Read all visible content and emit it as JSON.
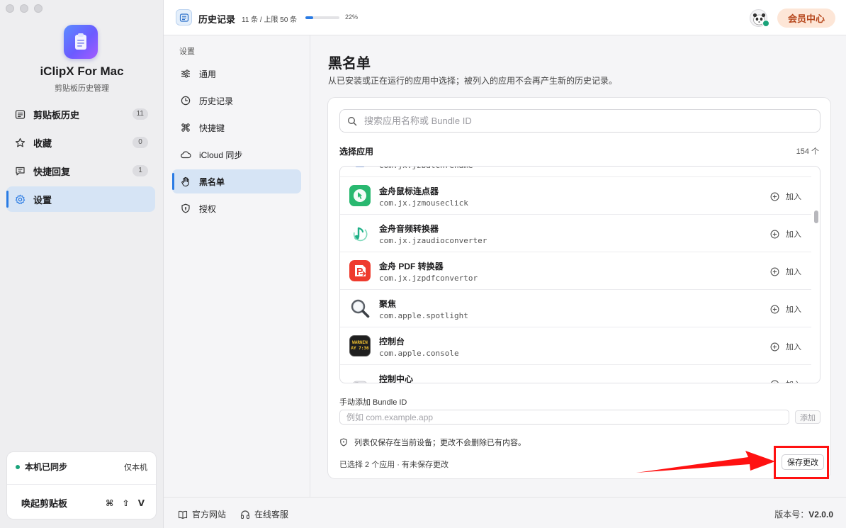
{
  "sidebar": {
    "app_name": "iClipX For Mac",
    "app_subtitle": "剪贴板历史管理",
    "items": [
      {
        "label": "剪贴板历史",
        "badge": "11"
      },
      {
        "label": "收藏",
        "badge": "0"
      },
      {
        "label": "快捷回复",
        "badge": "1"
      },
      {
        "label": "设置",
        "badge": ""
      }
    ],
    "sync": {
      "status": "本机已同步",
      "scope": "仅本机"
    },
    "wake": {
      "label": "唤起剪贴板",
      "shortcut": "⌘ ⇧ V"
    }
  },
  "topbar": {
    "title": "历史记录",
    "count": "11 条 / 上限 50 条",
    "progress": 0.22,
    "percent": "22%",
    "vip_label": "会员中心"
  },
  "settings_nav": {
    "heading": "设置",
    "items": [
      {
        "label": "通用",
        "icon": "sliders-icon"
      },
      {
        "label": "历史记录",
        "icon": "clock-icon"
      },
      {
        "label": "快捷键",
        "icon": "command-icon"
      },
      {
        "label": "iCloud 同步",
        "icon": "cloud-icon"
      },
      {
        "label": "黑名单",
        "icon": "hand-icon"
      },
      {
        "label": "授权",
        "icon": "shield-icon"
      }
    ]
  },
  "main": {
    "title": "黑名单",
    "description": "从已安装或正在运行的应用中选择；被列入的应用不会再产生新的历史记录。",
    "search_placeholder": "搜索应用名称或 Bundle ID",
    "select_label": "选择应用",
    "select_count": "154 个",
    "partial_top_id": "com.jx.jzbatchrename",
    "apps": [
      {
        "name": "金舟鼠标连点器",
        "id": "com.jx.jzmouseclick",
        "icon": "mouse-click-app-icon",
        "action": "加入"
      },
      {
        "name": "金舟音频转换器",
        "id": "com.jx.jzaudioconverter",
        "icon": "music-note-app-icon",
        "action": "加入"
      },
      {
        "name": "金舟 PDF 转换器",
        "id": "com.jx.jzpdfconvertor",
        "icon": "pdf-app-icon",
        "action": "加入"
      },
      {
        "name": "聚焦",
        "id": "com.apple.spotlight",
        "icon": "magnifier-app-icon",
        "action": "加入"
      },
      {
        "name": "控制台",
        "id": "com.apple.console",
        "icon": "console-app-icon",
        "action": "加入",
        "icon_text": [
          "WARNIN",
          "AY 7:36"
        ]
      },
      {
        "name": "控制中心",
        "id": "",
        "icon": "toggle-app-icon",
        "action": "加入"
      }
    ],
    "manual_label": "手动添加 Bundle ID",
    "manual_placeholder": "例如 com.example.app",
    "manual_button": "添加",
    "note": "列表仅保存在当前设备；更改不会删除已有内容。",
    "status": "已选择 2 个应用 · 有未保存更改",
    "save_button": "保存更改"
  },
  "footer": {
    "website": "官方网站",
    "support": "在线客服",
    "version_label": "版本号：",
    "version": "V2.0.0"
  },
  "colors": {
    "accent": "#2a7be4",
    "active_bg": "#d6e4f5",
    "vip_bg": "#fde6d7",
    "vip_text": "#b5451a",
    "sync_green": "#1aa37a",
    "annotation_red": "#ff1111"
  }
}
